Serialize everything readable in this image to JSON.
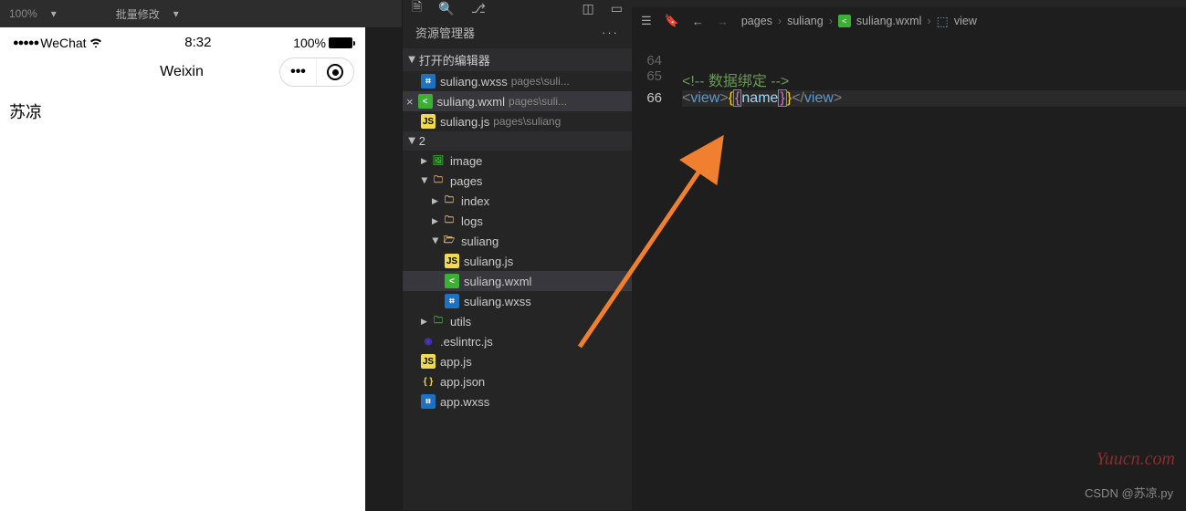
{
  "topbar": {
    "pct": "100%",
    "label2": "批量修改"
  },
  "simulator": {
    "carrier": "WeChat",
    "time": "8:32",
    "battery": "100%",
    "title": "Weixin",
    "body_text": "苏凉"
  },
  "explorer": {
    "title": "资源管理器",
    "open_editors_label": "打开的编辑器",
    "root": "2",
    "open_editors": [
      {
        "name": "suliang.wxss",
        "path": "pages\\suli...",
        "icon": "wxss"
      },
      {
        "name": "suliang.wxml",
        "path": "pages\\suli...",
        "icon": "wxml",
        "active": true
      },
      {
        "name": "suliang.js",
        "path": "pages\\suliang",
        "icon": "js"
      }
    ],
    "tree": {
      "image": "image",
      "pages": "pages",
      "index": "index",
      "logs": "logs",
      "suliang_folder": "suliang",
      "suliang_js": "suliang.js",
      "suliang_wxml": "suliang.wxml",
      "suliang_wxss": "suliang.wxss",
      "utils": "utils",
      "eslintrc": ".eslintrc.js",
      "app_js": "app.js",
      "app_json": "app.json",
      "app_wxss": "app.wxss"
    }
  },
  "breadcrumb": {
    "p1": "pages",
    "p2": "suliang",
    "p3": "suliang.wxml",
    "p4": "view"
  },
  "code": {
    "line64": "64",
    "line65": "65",
    "line66": "66",
    "comment_open": "<!--",
    "comment_text": " 数据绑定 ",
    "comment_close": "-->",
    "tag": "view",
    "var": "name"
  },
  "watermarks": {
    "w1": "Yuucn.com",
    "w2": "CSDN @苏凉.py"
  }
}
